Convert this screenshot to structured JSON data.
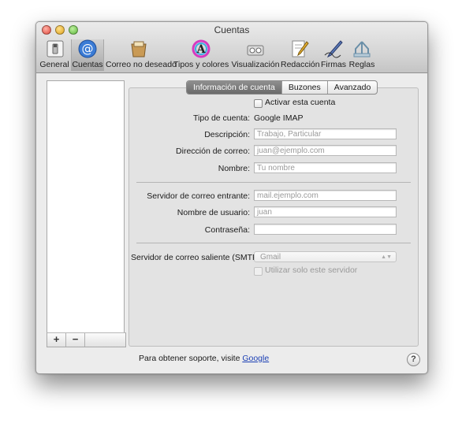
{
  "window": {
    "title": "Cuentas"
  },
  "toolbar": {
    "items": [
      {
        "label": "General",
        "icon": "general-switch-icon"
      },
      {
        "label": "Cuentas",
        "icon": "at-sign-icon",
        "selected": true
      },
      {
        "label": "Correo no deseado",
        "icon": "junk-mail-icon"
      },
      {
        "label": "Tipos y colores",
        "icon": "fonts-colors-icon"
      },
      {
        "label": "Visualización",
        "icon": "viewing-glasses-icon"
      },
      {
        "label": "Redacción",
        "icon": "composing-pencil-icon"
      },
      {
        "label": "Firmas",
        "icon": "signature-pen-icon"
      },
      {
        "label": "Reglas",
        "icon": "rules-icon"
      }
    ]
  },
  "accounts_list": {
    "add_label": "+",
    "remove_label": "−"
  },
  "tabs": [
    {
      "label": "Información de cuenta",
      "active": true
    },
    {
      "label": "Buzones"
    },
    {
      "label": "Avanzado"
    }
  ],
  "form": {
    "enable_account_label": "Activar esta cuenta",
    "account_type_label": "Tipo de cuenta:",
    "account_type_value": "Google IMAP",
    "description_label": "Descripción:",
    "description_placeholder": "Trabajo, Particular",
    "email_label": "Dirección de correo:",
    "email_placeholder": "juan@ejemplo.com",
    "name_label": "Nombre:",
    "name_placeholder": "Tu nombre",
    "incoming_server_label": "Servidor de correo entrante:",
    "incoming_server_placeholder": "mail.ejemplo.com",
    "username_label": "Nombre de usuario:",
    "username_placeholder": "juan",
    "password_label": "Contraseña:",
    "password_value": "",
    "smtp_label": "Servidor de correo saliente (SMTP):",
    "smtp_value": "Gmail",
    "only_this_server_label": "Utilizar solo este servidor"
  },
  "footer": {
    "support_text": "Para obtener soporte, visite",
    "support_link": "Google",
    "help_label": "?"
  },
  "colors": {
    "link": "#1b3fb4",
    "selected_tab": "#7a7a7a",
    "accent_at": "#3a7bd5"
  }
}
